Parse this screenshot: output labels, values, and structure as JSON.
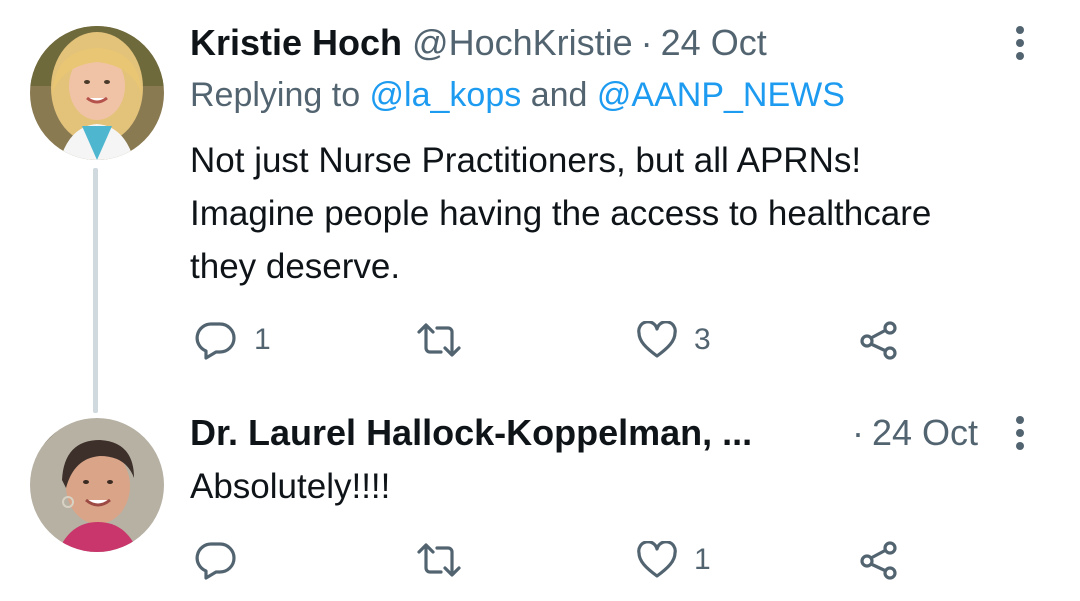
{
  "tweets": [
    {
      "author_name": "Kristie Hoch",
      "author_handle": "@HochKristie",
      "separator": "·",
      "date": "24 Oct",
      "reply_prefix": "Replying to ",
      "reply_mention_1": "@la_kops",
      "reply_and": " and ",
      "reply_mention_2": "@AANP_NEWS",
      "text_lines": [
        "Not just Nurse Practitioners, but all APRNs!",
        "Imagine people having the access to healthcare",
        "they deserve."
      ],
      "reply_count": "1",
      "retweet_count": "",
      "like_count": "3",
      "avatar_icon": "user-avatar-blonde"
    },
    {
      "author_name": "Dr. Laurel Hallock-Koppelman, ...",
      "separator": "·",
      "date": "24 Oct",
      "text": "Absolutely!!!!",
      "reply_count": "",
      "retweet_count": "",
      "like_count": "1",
      "avatar_icon": "user-avatar-short-hair"
    }
  ],
  "icons": {
    "reply": "reply-icon",
    "retweet": "retweet-icon",
    "like": "heart-icon",
    "share": "share-icon",
    "more": "more-vertical-icon"
  },
  "colors": {
    "text": "#0f1419",
    "secondary": "#536471",
    "link": "#1d9bf0",
    "thread_line": "#cfd9de"
  }
}
